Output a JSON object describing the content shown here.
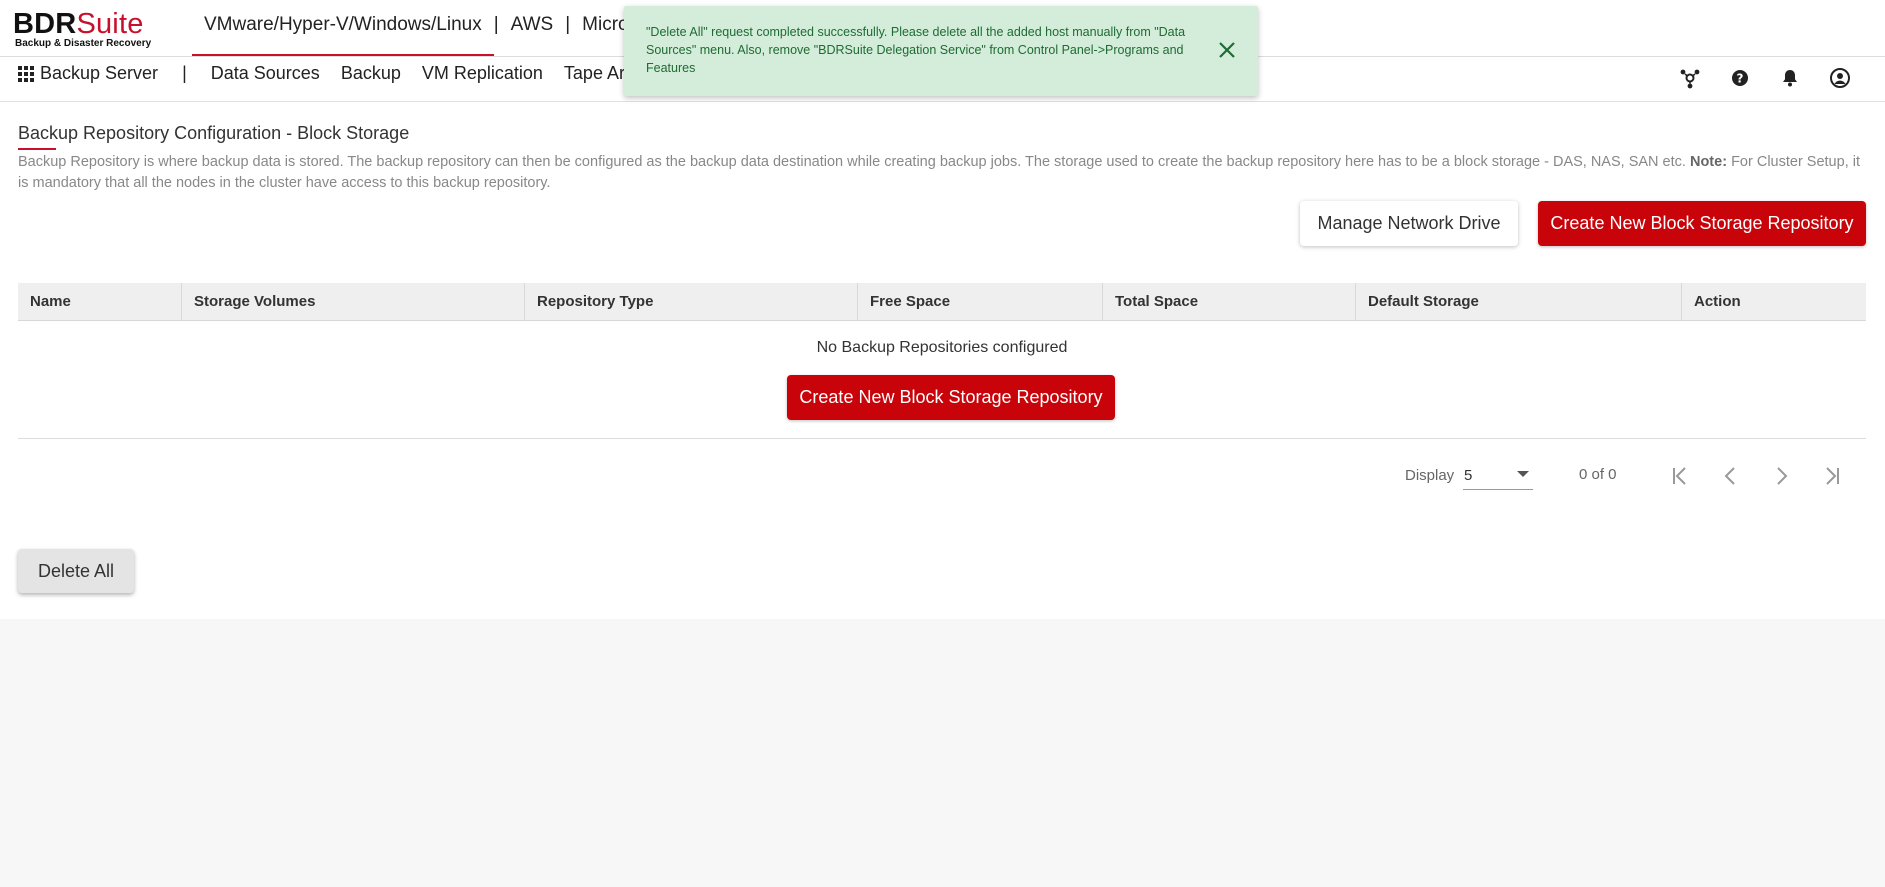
{
  "logo": {
    "name_part1": "BDR",
    "name_part2": "Suite",
    "subtitle": "Backup & Disaster Recovery"
  },
  "platforms": {
    "items": [
      "VMware/Hyper-V/Windows/Linux",
      "AWS",
      "Micros"
    ],
    "separator": "|",
    "active_index": 0
  },
  "nav": {
    "product": "Backup Server",
    "separator": "|",
    "items": [
      "Data Sources",
      "Backup",
      "VM Replication",
      "Tape Archi"
    ],
    "right_icons": [
      "users-network-icon",
      "help-icon",
      "bell-icon",
      "user-account-icon"
    ]
  },
  "toast": {
    "message": "\"Delete All\" request completed successfully. Please delete all the added host manually from \"Data Sources\" menu. Also, remove \"BDRSuite Delegation Service\" from Control Panel->Programs and Features",
    "type": "success",
    "close_icon": "close-icon"
  },
  "page": {
    "title": "Backup Repository Configuration - Block Storage",
    "description": "Backup Repository is where backup data is stored. The backup repository can then be configured as the backup data destination while creating backup jobs. The storage used to create the backup repository here has to be a block storage - DAS, NAS, SAN etc.",
    "note_label": "Note:",
    "note_text": "For Cluster Setup, it is mandatory that all the nodes in the cluster have access to this backup repository."
  },
  "actions": {
    "manage_network_drive": "Manage Network Drive",
    "create_repo": "Create New Block Storage Repository"
  },
  "table": {
    "columns": [
      "Name",
      "Storage Volumes",
      "Repository Type",
      "Free Space",
      "Total Space",
      "Default Storage",
      "Action"
    ],
    "rows": [],
    "empty_message": "No Backup Repositories configured",
    "empty_action": "Create New Block Storage Repository"
  },
  "pager": {
    "display_label": "Display",
    "page_size": "5",
    "count": "0 of 0",
    "buttons": [
      "first-page-icon",
      "prev-page-icon",
      "next-page-icon",
      "last-page-icon"
    ]
  },
  "footer_actions": {
    "delete_all": "Delete All"
  },
  "colors": {
    "accent": "#c8040a",
    "toast_bg": "#d4edda",
    "toast_text": "#1e6b33"
  }
}
